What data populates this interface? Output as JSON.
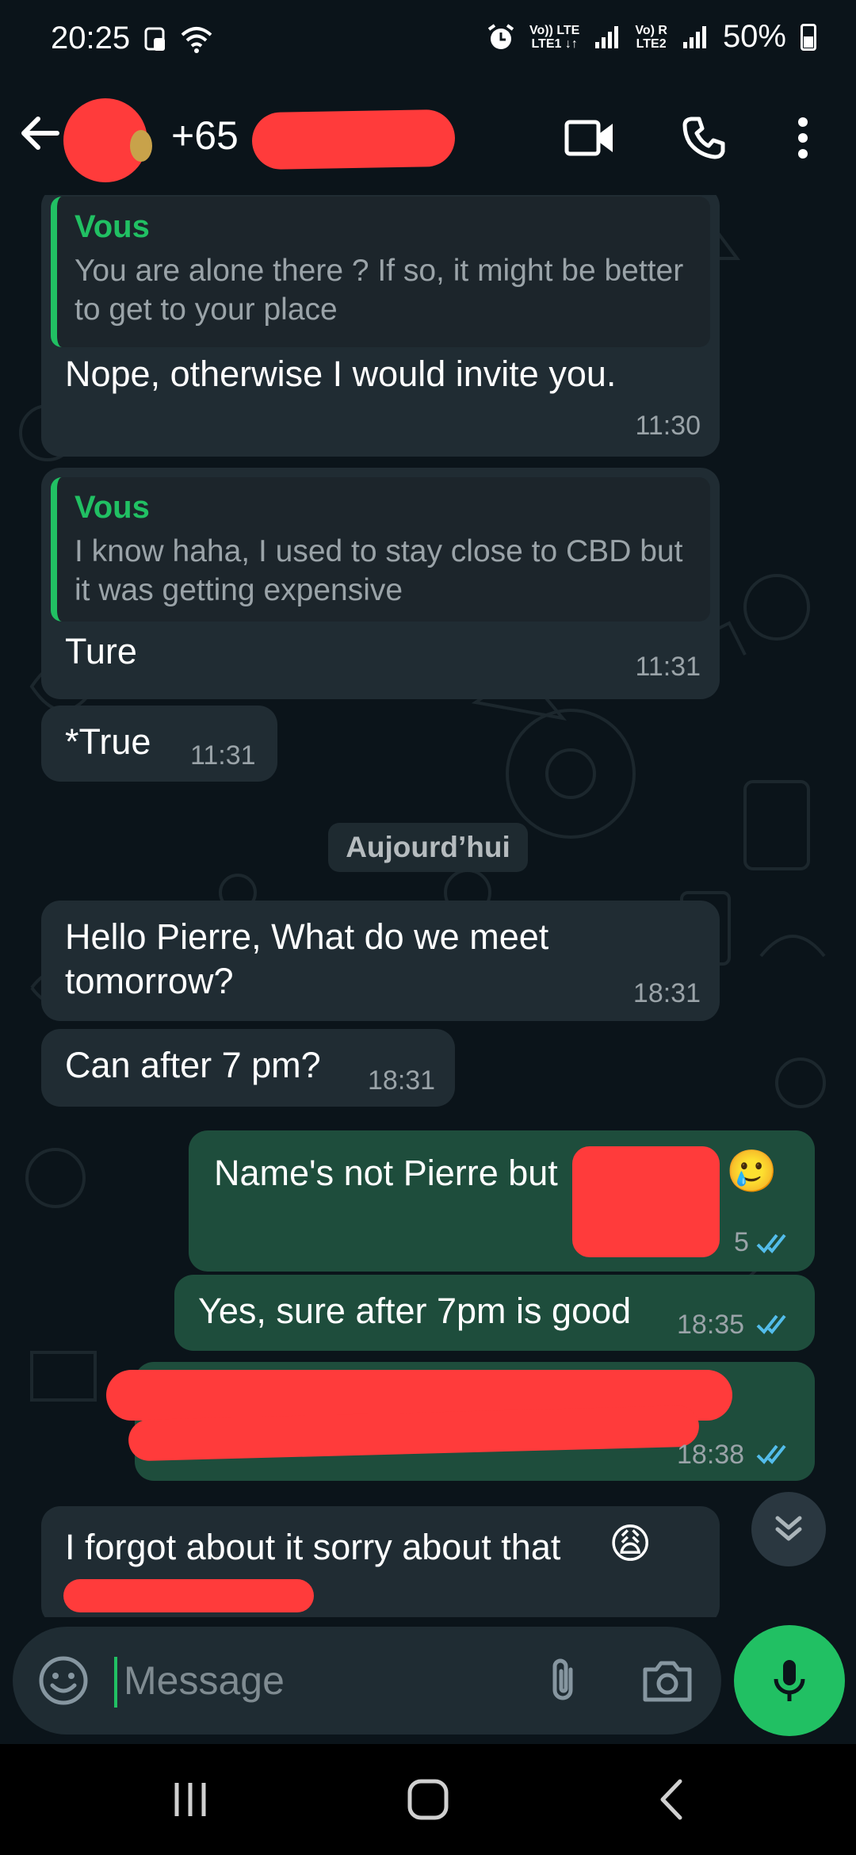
{
  "status_bar": {
    "time": "20:25",
    "net1_top": "Vo)) LTE",
    "net1_bottom": "LTE1 ↓↑",
    "net2_top": "Vo) R",
    "net2_bottom": "LTE2",
    "battery": "50%"
  },
  "header": {
    "contact_number": "+65"
  },
  "messages": [
    {
      "direction": "in",
      "quote_author": "Vous",
      "quote_text": "You are alone there ? If so, it might be better to get to your place",
      "text": "Nope, otherwise I would invite you.",
      "time": "11:30"
    },
    {
      "direction": "in",
      "quote_author": "Vous",
      "quote_text": "I know haha, I used to stay close to CBD but it was getting expensive",
      "text": "Ture",
      "time": "11:31"
    },
    {
      "direction": "in",
      "text": "*True",
      "time": "11:31"
    },
    {
      "direction": "in",
      "text": "Hello Pierre, What do we meet tomorrow?",
      "time": "18:31"
    },
    {
      "direction": "in",
      "text": "Can after 7 pm?",
      "time": "18:31"
    },
    {
      "direction": "out",
      "text": "Name's not Pierre but",
      "emoji": "🥲",
      "time": "5"
    },
    {
      "direction": "out",
      "text": "Yes, sure after 7pm is good",
      "time": "18:35"
    },
    {
      "direction": "out",
      "text": "",
      "time": "18:38"
    },
    {
      "direction": "in",
      "text": "I forgot about it sorry about that",
      "emoji": "😩"
    }
  ],
  "date_separator": "Aujourd’hui",
  "input": {
    "placeholder": "Message"
  },
  "colors": {
    "accent": "#21c063",
    "outgoing": "#1e4d3c",
    "incoming": "#202c33",
    "read_ticks": "#53bdeb"
  },
  "icons": [
    "back-arrow-icon",
    "video-call-icon",
    "phone-icon",
    "more-options-icon",
    "emoji-icon",
    "attach-icon",
    "camera-icon",
    "mic-icon",
    "double-chevron-down-icon"
  ]
}
